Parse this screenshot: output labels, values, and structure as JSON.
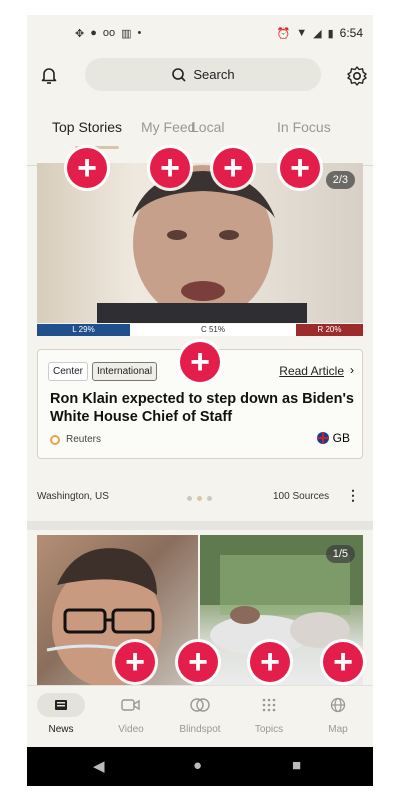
{
  "status_bar": {
    "time": "6:54",
    "left_icons": [
      "location-icon",
      "chat-icon",
      "voicemail-icon",
      "book-icon",
      "dot-icon"
    ],
    "right_icons": [
      "alarm-icon",
      "wifi-icon",
      "signal-icon",
      "battery-icon"
    ]
  },
  "header": {
    "search_label": "Search"
  },
  "tabs": [
    "Top Stories",
    "My Feed",
    "Local",
    "In Focus"
  ],
  "story1": {
    "image_counter": "2/3",
    "bias": {
      "left": "L 29%",
      "center": "C 51%",
      "right": "R 20%"
    },
    "tags": [
      "Center",
      "International"
    ],
    "read_article": "Read Article",
    "headline": "Ron Klain expected to step down as Biden's White House Chief of Staff",
    "source": "Reuters",
    "country": "GB",
    "location": "Washington, US",
    "sources_count": "100 Sources"
  },
  "story2": {
    "image_counter": "1/5"
  },
  "bottom_nav": [
    {
      "label": "News",
      "icon": "news-icon"
    },
    {
      "label": "Video",
      "icon": "video-icon"
    },
    {
      "label": "Blindspot",
      "icon": "blindspot-icon"
    },
    {
      "label": "Topics",
      "icon": "topics-icon"
    },
    {
      "label": "Map",
      "icon": "globe-icon"
    }
  ],
  "plus_label": "+",
  "colors": {
    "accent": "#e31e4a",
    "bias_left": "#1f4f8d",
    "bias_right": "#9c2b2b",
    "background": "#f4f3ee"
  }
}
